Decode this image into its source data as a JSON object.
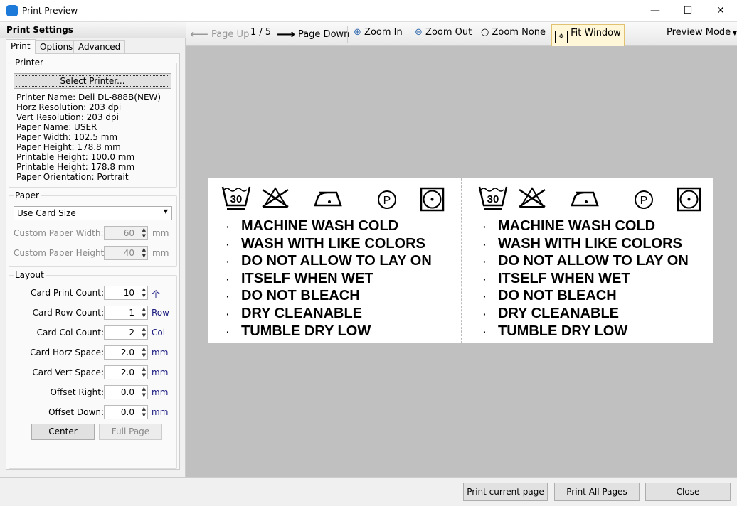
{
  "window": {
    "title": "Print Preview",
    "minimize": "—",
    "maximize": "☐",
    "close": "✕"
  },
  "left": {
    "header": "Print Settings",
    "tabs": [
      "Print",
      "Options",
      "Advanced"
    ],
    "printer": {
      "label": "Printer",
      "select_button": "Select Printer...",
      "info": [
        "Printer Name: Deli DL-888B(NEW)",
        "Horz Resolution: 203 dpi",
        "Vert Resolution: 203 dpi",
        "Paper Name: USER",
        "Paper Width: 102.5 mm",
        "Paper Height: 178.8 mm",
        "Printable Height: 100.0 mm",
        "Printable Height: 178.8 mm",
        "Paper Orientation: Portrait"
      ]
    },
    "paper": {
      "label": "Paper",
      "size_select": "Use Card Size",
      "custom_width_label": "Custom Paper Width:",
      "custom_width": "60",
      "custom_height_label": "Custom Paper Height:",
      "custom_height": "40",
      "unit": "mm"
    },
    "layout": {
      "label": "Layout",
      "fields": [
        {
          "label": "Card Print Count:",
          "value": "10",
          "unit": "个"
        },
        {
          "label": "Card Row Count:",
          "value": "1",
          "unit": "Row"
        },
        {
          "label": "Card Col Count:",
          "value": "2",
          "unit": "Col"
        },
        {
          "label": "Card Horz Space:",
          "value": "2.0",
          "unit": "mm"
        },
        {
          "label": "Card Vert Space:",
          "value": "2.0",
          "unit": "mm"
        },
        {
          "label": "Offset Right:",
          "value": "0.0",
          "unit": "mm"
        },
        {
          "label": "Offset Down:",
          "value": "0.0",
          "unit": "mm"
        }
      ],
      "center_button": "Center",
      "full_page_button": "Full Page"
    }
  },
  "toolbar": {
    "page_up": "Page Up",
    "page_indicator": "1 / 5",
    "page_down": "Page Down",
    "zoom_in": "Zoom In",
    "zoom_out": "Zoom Out",
    "zoom_none": "Zoom None",
    "fit_window": "Fit Window",
    "preview_mode": "Preview Mode"
  },
  "card": {
    "lines": [
      "MACHINE WASH COLD",
      "WASH WITH LIKE COLORS",
      "DO NOT ALLOW TO LAY ON",
      "ITSELF WHEN WET",
      "DO NOT BLEACH",
      "DRY CLEANABLE",
      "TUMBLE DRY LOW"
    ],
    "wash_temp": "30",
    "dryclean_letter": "P",
    "bullet": "·"
  },
  "bottom": {
    "print_current": "Print current page",
    "print_all": "Print All Pages",
    "close": "Close"
  }
}
